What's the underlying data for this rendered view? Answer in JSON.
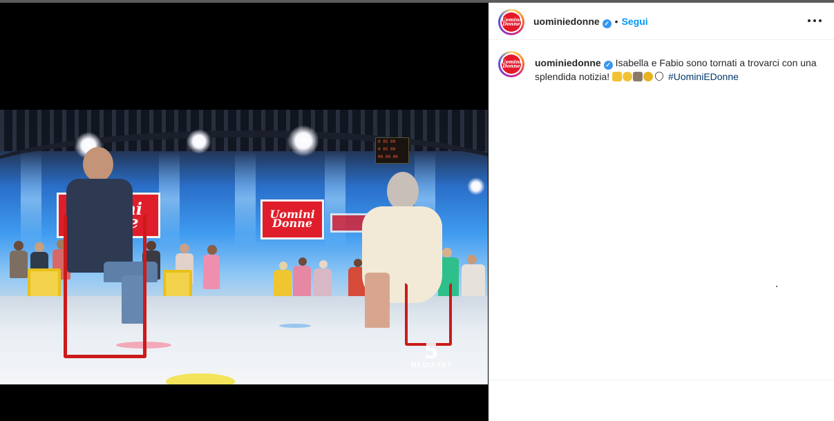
{
  "post": {
    "account": {
      "username": "uominiedonne",
      "avatar_text": "Uomini Donne",
      "verified": true,
      "verified_glyph": "✓",
      "separator": "•",
      "follow_label": "Segui"
    },
    "caption": {
      "username": "uominiedonne",
      "text_line": "Isabella e Fabio sono tornati a trovarci con una splendida notizia!",
      "emojis": [
        "hugging-face-emoji",
        "ring-emoji",
        "bride-groom-emoji",
        "wedding-rings-emoji",
        "white-heart-emoji"
      ],
      "hashtag": "#UominiEDonne"
    },
    "media": {
      "studio_logo_text": "Uomini Donne",
      "broadcaster_glyph": "5",
      "broadcaster_name": "MEDIASET"
    },
    "more_menu_icon": "more-horizontal-icon"
  },
  "colors": {
    "accent_blue": "#0095f6",
    "verified_blue": "#3897f0",
    "hashtag": "#00376b",
    "brand_red": "#e01e2b"
  }
}
